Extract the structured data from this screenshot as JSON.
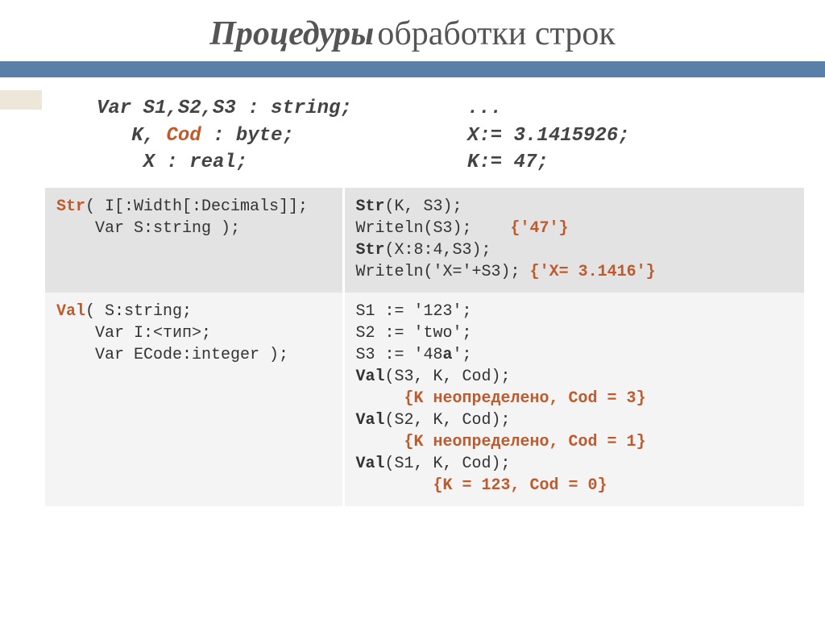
{
  "title": {
    "part1": "Процедуры",
    "part2": " обработки строк"
  },
  "decl": {
    "l1a": "Var S1,S2,S3 : string;",
    "l2a": "K,",
    "l2b": "Cod",
    "l2c": ": byte;",
    "l3": "X : real;"
  },
  "assign": {
    "l1": "...",
    "l2": "X:= 3.1415926;",
    "l3": "K:= 47;"
  },
  "rows": [
    {
      "sig": {
        "fn": "Str",
        "rest1": "( I[:Width[:Decimals]];",
        "rest2": "Var S:string );"
      },
      "ex": {
        "l1b": "Str",
        "l1": "(K, S3);",
        "l2": "Writeln(S3);",
        "l2c": "{'47'}",
        "l3b": "Str",
        "l3": "(X:8:4,S3);",
        "l4": "Writeln('X='+S3);",
        "l4c": "{'X=  3.1416'}"
      }
    },
    {
      "sig": {
        "fn": "Val",
        "rest1": "( S:string;",
        "rest2": "Var I:<тип>;",
        "rest3": "Var ECode:integer );"
      },
      "ex": {
        "l1": "S1 := '123';",
        "l2": "S2 := 'two';",
        "l3a": "S3 := '48",
        "l3b": "a",
        "l3c": "';",
        "l4b": "Val",
        "l4": "(S3, K, Cod);",
        "l5c": "{K неопределено, Cod = 3}",
        "l6b": "Val",
        "l6": "(S2, K, Cod);",
        "l7c": "{K неопределено, Cod = 1}",
        "l8b": "Val",
        "l8": "(S1, K, Cod);",
        "l9c": "{K = 123, Cod = 0}"
      }
    }
  ]
}
